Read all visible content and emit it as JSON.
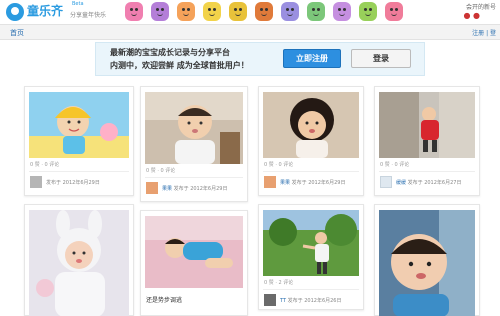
{
  "header": {
    "logo_text": "童乐齐",
    "logo_beta": "Beta",
    "logo_sub": "分享童年快乐",
    "user_links": "会开的新号",
    "user_icons": "● ●"
  },
  "nav": {
    "home": "首页",
    "right": "注册 | 登"
  },
  "banner": {
    "line1": "最新潮的宝宝成长记录与分享平台",
    "line2": "内测中，欢迎尝鲜 成为全球首批用户！",
    "register_label": "立即注册",
    "login_label": "登录"
  },
  "colors": {
    "brand": "#2b9be0",
    "register_button": "#2d8fe0",
    "banner_bg": "#eaf5fb",
    "link": "#2a6fb0"
  },
  "cards": [
    {
      "stats": "0 赞 · 0 评论",
      "user": "",
      "posted": "发布于 2012年6月29日",
      "caption": ""
    },
    {
      "stats": "0 赞 · 0 评论",
      "user": "果果",
      "posted": "发布于 2012年6月29日",
      "caption": ""
    },
    {
      "stats": "0 赞 · 0 评论",
      "user": "果果",
      "posted": "发布于 2012年6月29日",
      "caption": ""
    },
    {
      "stats": "0 赞 · 0 评论",
      "user": "缓缓",
      "posted": "发布于 2012年6月27日",
      "caption": ""
    },
    {
      "stats": "",
      "user": "",
      "posted": "",
      "caption": ""
    },
    {
      "stats": "",
      "user": "",
      "posted": "",
      "caption": "还是势步调逃"
    },
    {
      "stats": "0 赞 · 2 评论",
      "user": "TT",
      "posted": "发布于 2012年6月26日",
      "caption": ""
    },
    {
      "stats": "",
      "user": "",
      "posted": "",
      "caption": ""
    }
  ]
}
